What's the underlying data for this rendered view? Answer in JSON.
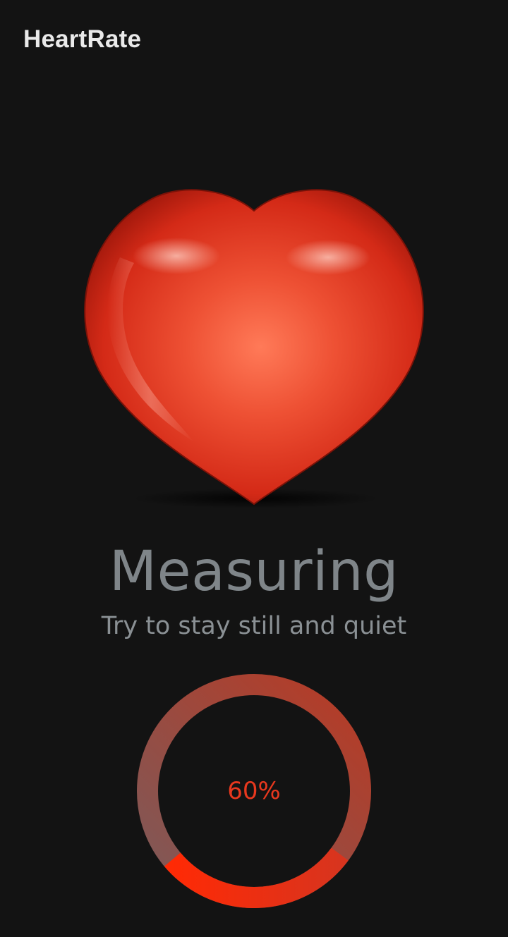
{
  "app": {
    "title": "HeartRate"
  },
  "heart": {
    "icon": "heart-icon",
    "colors": {
      "highlight": "#ff7a58",
      "mid": "#e03a22",
      "edge": "#8f1208"
    }
  },
  "measurement": {
    "status": "Measuring",
    "hint": "Try to stay still and quiet"
  },
  "progress": {
    "value": 0.6,
    "label": "60%",
    "colors": {
      "track_start": "#7d5a5a",
      "track_end": "#b83a24",
      "fill_start": "#ff2a05",
      "fill_end": "#d8341e",
      "text": "#e8381e"
    }
  }
}
